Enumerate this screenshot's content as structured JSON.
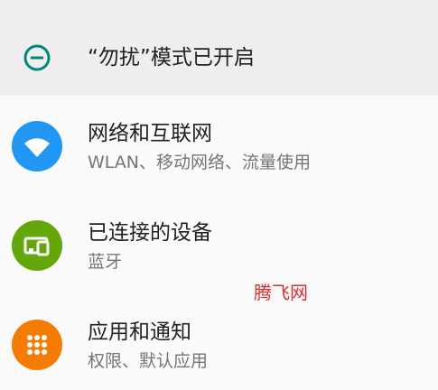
{
  "dnd_banner": {
    "text": "“勿扰”模式已开启",
    "icon": "do-not-disturb-icon",
    "color": "#00897b"
  },
  "settings": [
    {
      "title": "网络和互联网",
      "subtitle": "WLAN、移动网络、流量使用",
      "icon": "wifi-icon",
      "color": "#2196f3"
    },
    {
      "title": "已连接的设备",
      "subtitle": "蓝牙",
      "icon": "connected-devices-icon",
      "color": "#64a70b"
    },
    {
      "title": "应用和通知",
      "subtitle": "权限、默认应用",
      "icon": "apps-grid-icon",
      "color": "#f57c00"
    }
  ],
  "watermark": "腾飞网"
}
